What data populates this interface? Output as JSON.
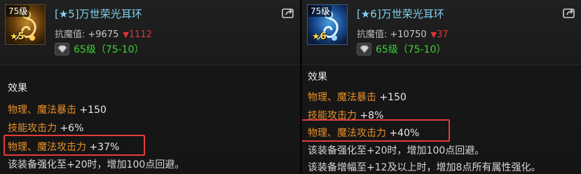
{
  "left": {
    "level_badge": "75级",
    "star_badge": "★5",
    "item_name": "[★5]万世荣光耳环",
    "stat_label": "抗魔值:",
    "stat_value": "+9675",
    "stat_delta": "1112",
    "gem_text": "65级（75-10）",
    "effect_title": "效果",
    "options": [
      {
        "label": "物理、魔法暴击",
        "value": "+150"
      },
      {
        "label": "技能攻击力",
        "value": "+6%"
      },
      {
        "label": "物理、魔法攻击力",
        "value": "+37%"
      }
    ],
    "note": "该装备强化至+20时，增加100点回避。"
  },
  "right": {
    "level_badge": "75级",
    "star_badge": "★6",
    "item_name": "[★6]万世荣光耳环",
    "stat_label": "抗魔值:",
    "stat_value": "+10750",
    "stat_delta": "37",
    "gem_text": "65级（75-10）",
    "effect_title": "效果",
    "options": [
      {
        "label": "物理、魔法暴击",
        "value": "+150"
      },
      {
        "label": "技能攻击力",
        "value": "+8%"
      },
      {
        "label": "物理、魔法攻击力",
        "value": "+40%"
      }
    ],
    "notes": [
      "该装备强化至+20时，增加100点回避。",
      "该装备增幅至+12及以上时，增加8点所有属性强化。"
    ]
  },
  "colors": {
    "name": "#7fd2f0",
    "option_label": "#e8902a",
    "gem_text": "#3fd23a",
    "delta": "#e0363a",
    "highlight": "#e23b3b"
  },
  "icons": [
    "earring-icon",
    "diamond-gem-icon",
    "share-icon"
  ]
}
